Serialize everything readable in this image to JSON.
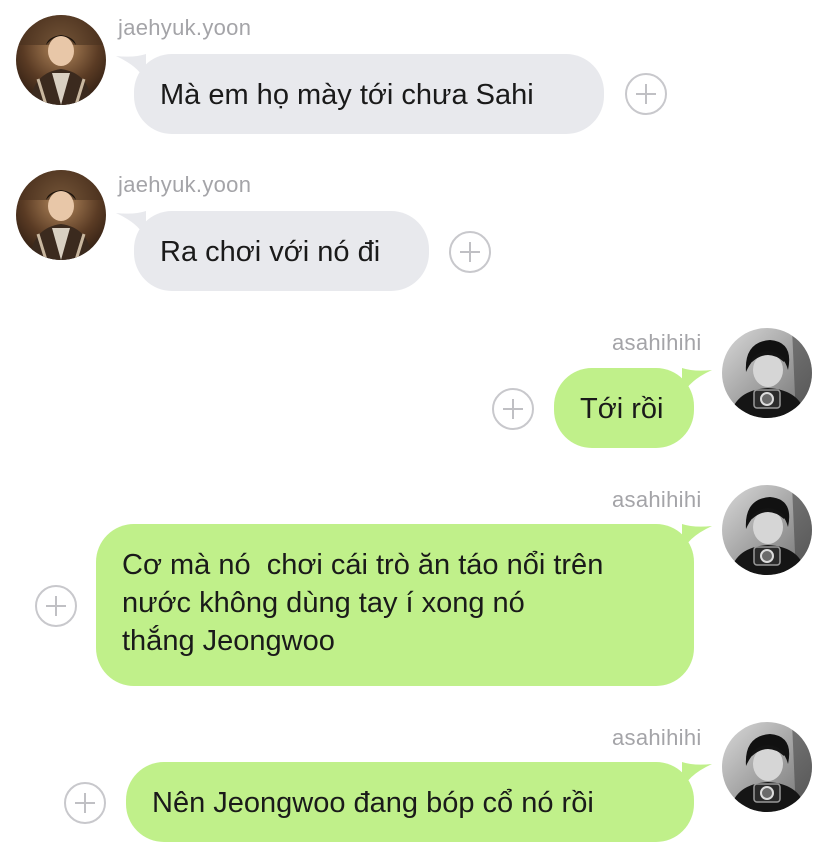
{
  "messages": [
    {
      "sender": "jaehyuk.yoon",
      "direction": "incoming",
      "text": "Mà em họ mày tới chưa Sahi"
    },
    {
      "sender": "jaehyuk.yoon",
      "direction": "incoming",
      "text": "Ra chơi với nó đi"
    },
    {
      "sender": "asahihihi",
      "direction": "outgoing",
      "text": "Tới rồi"
    },
    {
      "sender": "asahihihi",
      "direction": "outgoing",
      "text": "Cơ mà nó  chơi cái trò ăn táo nổi trên\nnước không dùng tay í xong nó\nthắng Jeongwoo"
    },
    {
      "sender": "asahihihi",
      "direction": "outgoing",
      "text": "Nên Jeongwoo đang bóp cổ nó rồi"
    }
  ],
  "colors": {
    "incoming_bubble": "#e8e9ed",
    "outgoing_bubble": "#c0f08a",
    "username": "#a4a4a8"
  },
  "icons": {
    "react": "plus-circle-icon",
    "avatar_jaehyuk": "avatar-photo-jaehyuk",
    "avatar_asahi": "avatar-photo-asahi"
  }
}
